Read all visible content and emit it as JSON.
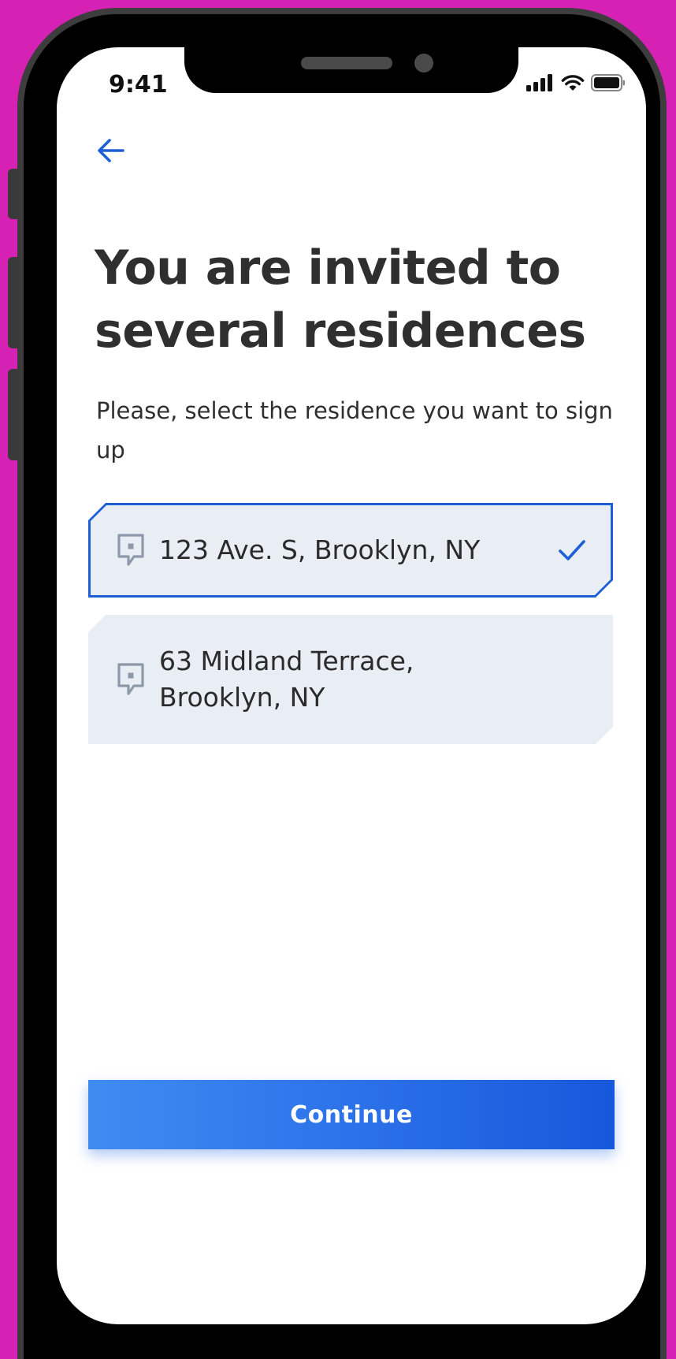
{
  "status_bar": {
    "time": "9:41",
    "icons": [
      "cellular-signal-icon",
      "wifi-icon",
      "battery-icon"
    ]
  },
  "header": {
    "back_icon": "arrow-left-icon",
    "title": "You are invited to several residences",
    "subtitle": "Please, select the residence you want to sign up"
  },
  "residences": [
    {
      "address": "123 Ave. S, Brooklyn, NY",
      "selected": true,
      "icon": "location-pin-icon"
    },
    {
      "address": "63 Midland Terrace, Brooklyn, NY",
      "selected": false,
      "icon": "location-pin-icon"
    }
  ],
  "actions": {
    "continue_label": "Continue"
  },
  "colors": {
    "background": "#d622b4",
    "accent": "#1f5fd6",
    "card_background": "#e9eef5",
    "text": "#2f2f2f",
    "button_gradient_start": "#3f8cf1",
    "button_gradient_end": "#1658db"
  }
}
